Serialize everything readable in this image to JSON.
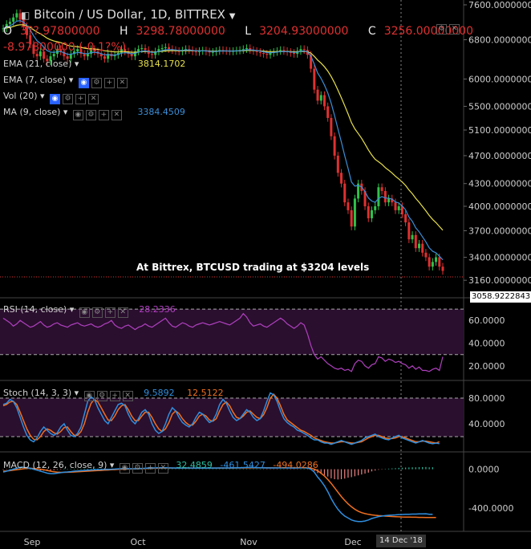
{
  "header": {
    "title": "Bitcoin / US Dollar, 1D, BITTREX",
    "ohlc": {
      "o_label": "O",
      "o": "3??.97800000",
      "h_label": "H",
      "h": "3298.78000000",
      "l_label": "L",
      "l": "3204.93000000",
      "c_label": "C",
      "c": "3256.00000000"
    },
    "change": "-8.97800000 (-0.1?%)"
  },
  "indicators": {
    "ema21": {
      "label": "EMA (21, close)",
      "value": "3814.1702"
    },
    "ema7": {
      "label": "EMA (7, close)",
      "value": ""
    },
    "vol": {
      "label": "Vol (20)",
      "value": ""
    },
    "ma9": {
      "label": "MA (9, close)",
      "value": "3384.4509"
    },
    "rsi": {
      "label": "RSI (14, close)",
      "value": "28.2336"
    },
    "stoch": {
      "label": "Stoch (14, 3, 3)",
      "k": "9.5892",
      "d": "12.5122"
    },
    "macd": {
      "label": "MACD (12, 26, close, 9)",
      "v1": "32.4859",
      "v2": "-461.5427",
      "v3": "-494.0286"
    }
  },
  "annotation": "At Bittrex, BTCUSD trading at $3204  levels",
  "price_tag": "3058.92228437",
  "date_tag": "14 Dec '18",
  "colors": {
    "up": "#2fc24a",
    "down": "#e03030",
    "ema21": "#e8e04a",
    "ema7": "#3b8fd8",
    "rsi": "#b040c0",
    "stochK": "#2f8fe0",
    "stochD": "#f07020",
    "macd": "#2f8fe0",
    "signal": "#f07020",
    "panel": "#2a0f2e"
  },
  "chart_data": [
    {
      "type": "candlestick",
      "x_ticks": [
        "Sep",
        "Oct",
        "Nov",
        "Dec"
      ],
      "y_ticks": [
        "7600.00000000",
        "6800.00000000",
        "6000.00000000",
        "5500.00000000",
        "5100.00000000",
        "4700.00000000",
        "4300.00000000",
        "4000.00000000",
        "3700.00000000",
        "3400.00000000",
        "3160.00000000"
      ],
      "ylim": [
        3058,
        7600
      ],
      "closes": [
        7050,
        7150,
        7200,
        7300,
        7400,
        7250,
        7100,
        6900,
        6700,
        6500,
        6450,
        6550,
        6400,
        6350,
        6450,
        6500,
        6600,
        6550,
        6450,
        6400,
        6500,
        6550,
        6600,
        6500,
        6450,
        6500,
        6600,
        6550,
        6500,
        6450,
        6400,
        6500,
        6450,
        6480,
        6520,
        6600,
        6550,
        6500,
        6450,
        6550,
        6600,
        6620,
        6580,
        6500,
        6480,
        6550,
        6600,
        6620,
        6640,
        6600,
        6580,
        6560,
        6550,
        6570,
        6600,
        6580,
        6550,
        6540,
        6560,
        6570,
        6550,
        6530,
        6540,
        6560,
        6580,
        6570,
        6560,
        6550,
        6560,
        6570,
        6580,
        6600,
        6620,
        6580,
        6560,
        6540,
        6520,
        6500,
        6480,
        6520,
        6540,
        6560,
        6580,
        6560,
        6540,
        6520,
        6500,
        6560,
        6600,
        6580,
        6480,
        6200,
        5800,
        5600,
        5700,
        5500,
        5300,
        5000,
        4700,
        4450,
        4300,
        4050,
        3950,
        3750,
        4100,
        4300,
        4200,
        4000,
        3850,
        3950,
        4000,
        4250,
        4200,
        4050,
        4100,
        4050,
        3950,
        4000,
        3900,
        3800,
        3600,
        3650,
        3500,
        3550,
        3450,
        3400,
        3300,
        3350,
        3400,
        3300,
        3256
      ]
    },
    {
      "type": "line",
      "name": "",
      "y_ticks": [
        "60.0000",
        "40.0000",
        "20.0000"
      ],
      "ylim": [
        10,
        75
      ],
      "values": [
        62,
        60,
        58,
        55,
        57,
        60,
        58,
        56,
        54,
        55,
        57,
        59,
        56,
        54,
        55,
        57,
        58,
        56,
        55,
        54,
        56,
        57,
        58,
        56,
        55,
        56,
        57,
        55,
        54,
        55,
        57,
        58,
        60,
        56,
        54,
        53,
        55,
        56,
        54,
        52,
        54,
        55,
        57,
        55,
        54,
        56,
        58,
        60,
        62,
        58,
        55,
        54,
        56,
        58,
        57,
        55,
        54,
        56,
        57,
        58,
        57,
        56,
        57,
        58,
        59,
        58,
        57,
        56,
        58,
        60,
        62,
        66,
        63,
        58,
        55,
        56,
        57,
        55,
        54,
        56,
        58,
        60,
        62,
        60,
        57,
        55,
        53,
        55,
        58,
        56,
        48,
        38,
        30,
        26,
        28,
        25,
        22,
        20,
        18,
        17,
        18,
        16,
        17,
        15,
        22,
        25,
        24,
        20,
        18,
        21,
        22,
        28,
        27,
        24,
        26,
        25,
        23,
        24,
        22,
        21,
        18,
        20,
        17,
        19,
        16,
        16,
        15,
        17,
        18,
        16,
        28
      ]
    },
    {
      "type": "line",
      "name": "",
      "y_ticks": [
        "80.0000",
        "40.0000"
      ],
      "ylim": [
        0,
        100
      ],
      "series": [
        {
          "name": "",
          "values": [
            70,
            72,
            78,
            75,
            65,
            50,
            35,
            22,
            15,
            12,
            18,
            28,
            35,
            30,
            25,
            22,
            26,
            35,
            40,
            30,
            22,
            20,
            25,
            35,
            55,
            75,
            82,
            78,
            65,
            55,
            45,
            40,
            50,
            60,
            70,
            72,
            68,
            55,
            45,
            40,
            48,
            58,
            62,
            55,
            40,
            30,
            25,
            28,
            40,
            55,
            65,
            60,
            50,
            42,
            38,
            35,
            40,
            50,
            58,
            55,
            48,
            42,
            45,
            55,
            70,
            78,
            72,
            60,
            50,
            45,
            48,
            55,
            62,
            58,
            50,
            45,
            48,
            60,
            75,
            88,
            85,
            75,
            60,
            48,
            42,
            38,
            35,
            30,
            28,
            25,
            22,
            18,
            15,
            15,
            12,
            10,
            10,
            8,
            10,
            12,
            14,
            12,
            10,
            8,
            10,
            12,
            14,
            18,
            20,
            22,
            24,
            20,
            18,
            16,
            15,
            18,
            20,
            22,
            18,
            16,
            14,
            12,
            10,
            12,
            14,
            12,
            10,
            9,
            10,
            9
          ]
        },
        {
          "name": "",
          "values": [
            68,
            70,
            74,
            75,
            70,
            58,
            45,
            32,
            22,
            16,
            15,
            20,
            28,
            32,
            30,
            26,
            24,
            28,
            34,
            35,
            28,
            22,
            22,
            28,
            40,
            58,
            72,
            78,
            74,
            65,
            55,
            46,
            45,
            52,
            62,
            68,
            70,
            62,
            52,
            45,
            45,
            52,
            58,
            58,
            50,
            40,
            32,
            28,
            32,
            42,
            55,
            60,
            56,
            48,
            42,
            38,
            38,
            44,
            52,
            55,
            52,
            46,
            44,
            48,
            60,
            70,
            74,
            68,
            58,
            50,
            48,
            52,
            58,
            60,
            55,
            50,
            48,
            54,
            65,
            80,
            86,
            80,
            68,
            55,
            46,
            42,
            38,
            34,
            30,
            28,
            25,
            22,
            18,
            16,
            14,
            12,
            11,
            10,
            10,
            11,
            12,
            12,
            11,
            10,
            10,
            11,
            12,
            15,
            18,
            20,
            22,
            22,
            20,
            18,
            17,
            17,
            18,
            20,
            20,
            18,
            16,
            14,
            12,
            12,
            13,
            13,
            12,
            11,
            10,
            12
          ]
        }
      ]
    },
    {
      "type": "line",
      "name": "",
      "y_ticks": [
        "0.0000",
        "-400.0000"
      ],
      "ylim": [
        -620,
        120
      ],
      "series": [
        {
          "name": "",
          "values": [
            -30,
            -20,
            -10,
            0,
            10,
            20,
            20,
            15,
            10,
            0,
            -10,
            -20,
            -30,
            -40,
            -45,
            -45,
            -40,
            -35,
            -30,
            -28,
            -25,
            -20,
            -18,
            -15,
            -12,
            -10,
            -8,
            -5,
            -4,
            -3,
            -2,
            -1,
            0,
            2,
            4,
            6,
            6,
            6,
            5,
            5,
            6,
            8,
            10,
            12,
            13,
            14,
            15,
            15,
            15,
            14,
            13,
            12,
            12,
            12,
            13,
            13,
            12,
            12,
            12,
            12,
            12,
            12,
            12,
            12,
            13,
            13,
            13,
            13,
            14,
            14,
            15,
            16,
            18,
            18,
            17,
            16,
            15,
            14,
            13,
            13,
            13,
            13,
            14,
            14,
            13,
            13,
            12,
            13,
            15,
            16,
            12,
            0,
            -30,
            -80,
            -120,
            -170,
            -230,
            -300,
            -360,
            -410,
            -450,
            -480,
            -500,
            -520,
            -530,
            -535,
            -535,
            -530,
            -520,
            -505,
            -495,
            -485,
            -480,
            -475,
            -472,
            -470,
            -468,
            -465,
            -464,
            -462,
            -461,
            -460,
            -460,
            -458,
            -457,
            -456,
            -462,
            -461
          ]
        },
        {
          "name": "",
          "values": [
            -20,
            -18,
            -15,
            -10,
            -5,
            0,
            5,
            8,
            10,
            8,
            5,
            0,
            -5,
            -12,
            -20,
            -26,
            -30,
            -32,
            -32,
            -31,
            -30,
            -28,
            -26,
            -24,
            -22,
            -20,
            -18,
            -16,
            -14,
            -12,
            -10,
            -8,
            -6,
            -4,
            -2,
            0,
            1,
            2,
            3,
            4,
            5,
            6,
            7,
            8,
            9,
            10,
            11,
            12,
            12,
            12,
            12,
            12,
            12,
            12,
            12,
            12,
            12,
            12,
            12,
            12,
            12,
            12,
            12,
            12,
            12,
            12,
            12,
            12,
            12,
            13,
            13,
            13,
            14,
            14,
            14,
            14,
            14,
            14,
            14,
            14,
            14,
            14,
            14,
            14,
            14,
            14,
            14,
            14,
            14,
            14,
            13,
            10,
            2,
            -15,
            -40,
            -70,
            -105,
            -145,
            -190,
            -235,
            -280,
            -320,
            -355,
            -385,
            -410,
            -430,
            -445,
            -455,
            -462,
            -468,
            -472,
            -475,
            -477,
            -480,
            -482,
            -484,
            -486,
            -488,
            -489,
            -490,
            -491,
            -492,
            -492,
            -493,
            -493,
            -494,
            -494,
            -494,
            -494
          ]
        }
      ]
    }
  ]
}
